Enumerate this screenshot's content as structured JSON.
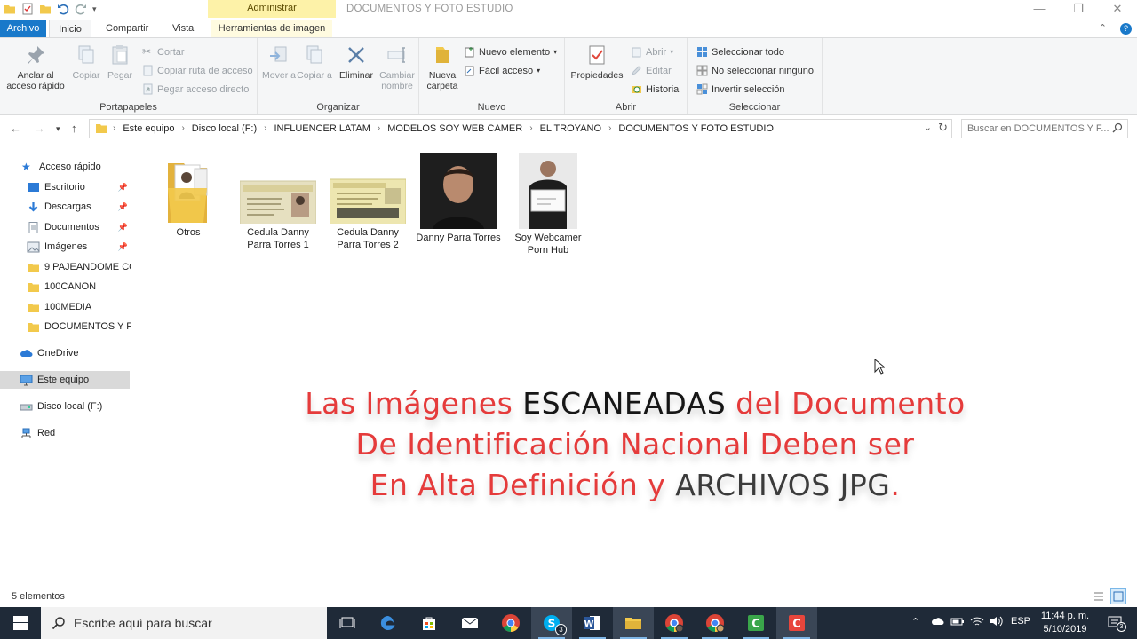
{
  "window": {
    "title": "DOCUMENTOS Y FOTO ESTUDIO",
    "context_tab_header": "Administrar"
  },
  "ribbon_tabs": {
    "archivo": "Archivo",
    "inicio": "Inicio",
    "compartir": "Compartir",
    "vista": "Vista",
    "herramientas": "Herramientas de imagen"
  },
  "ribbon": {
    "portapapeles": {
      "label": "Portapapeles",
      "anclar": "Anclar al acceso rápido",
      "copiar": "Copiar",
      "pegar": "Pegar",
      "cortar": "Cortar",
      "copiar_ruta": "Copiar ruta de acceso",
      "pegar_acceso": "Pegar acceso directo"
    },
    "organizar": {
      "label": "Organizar",
      "mover": "Mover a",
      "copiar_a": "Copiar a",
      "eliminar": "Eliminar",
      "cambiar_nombre": "Cambiar nombre"
    },
    "nuevo": {
      "label": "Nuevo",
      "nueva_carpeta": "Nueva carpeta",
      "nuevo_elemento": "Nuevo elemento",
      "facil_acceso": "Fácil acceso"
    },
    "abrir": {
      "label": "Abrir",
      "propiedades": "Propiedades",
      "abrir": "Abrir",
      "editar": "Editar",
      "historial": "Historial"
    },
    "seleccionar": {
      "label": "Seleccionar",
      "todo": "Seleccionar todo",
      "ninguno": "No seleccionar ninguno",
      "invertir": "Invertir selección"
    }
  },
  "address": {
    "crumbs": [
      "Este equipo",
      "Disco local (F:)",
      "INFLUENCER LATAM",
      "MODELOS SOY WEB CAMER",
      "EL TROYANO",
      "DOCUMENTOS Y FOTO ESTUDIO"
    ],
    "search_placeholder": "Buscar en DOCUMENTOS Y F..."
  },
  "nav_pane": {
    "acceso_rapido": "Acceso rápido",
    "items": [
      "Escritorio",
      "Descargas",
      "Documentos",
      "Imágenes",
      "9 PAJEANDOME CC",
      "100CANON",
      "100MEDIA",
      "DOCUMENTOS Y FC"
    ],
    "onedrive": "OneDrive",
    "este_equipo": "Este equipo",
    "disco": "Disco local (F:)",
    "red": "Red"
  },
  "files": [
    {
      "name": "Otros"
    },
    {
      "name": "Cedula Danny Parra Torres 1"
    },
    {
      "name": "Cedula Danny Parra Torres 2"
    },
    {
      "name": "Danny Parra Torres"
    },
    {
      "name": "Soy Webcamer Porn Hub"
    }
  ],
  "overlay": {
    "l1a": "Las Imágenes ",
    "l1b": "ESCANEADAS",
    "l1c": " del Documento",
    "l2": "De Identificación Nacional Deben ser",
    "l3a": "En Alta Definición y ",
    "l3b": "ARCHIVOS JPG",
    "l3c": "."
  },
  "status": {
    "count": "5 elementos"
  },
  "taskbar": {
    "search_text": "Escribe aquí para buscar",
    "lang": "ESP",
    "time": "11:44 p. m.",
    "date": "5/10/2019",
    "skype_badge": "3",
    "notif_badge": "3"
  }
}
